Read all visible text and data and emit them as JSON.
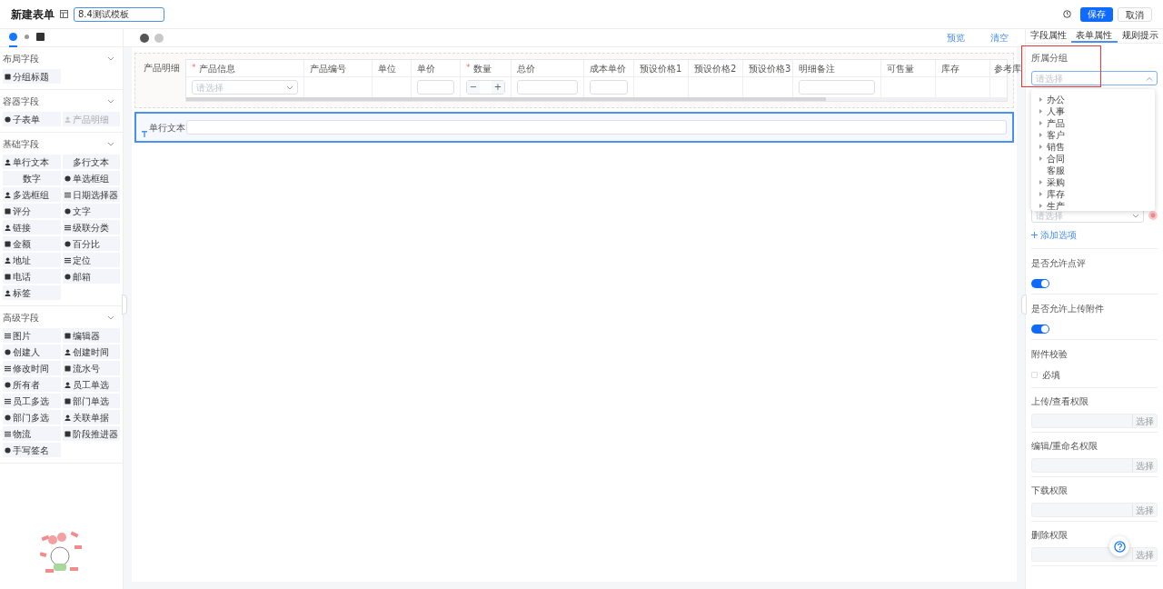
{
  "header": {
    "title": "新建表单",
    "template_name": "8.4测试模板",
    "save": "保存",
    "cancel": "取消"
  },
  "left_panel": {
    "icon_tabs": [
      {
        "selected": true
      },
      {
        "selected": false
      },
      {
        "selected": false
      }
    ],
    "sections": [
      {
        "title": "布局字段",
        "items": [
          {
            "label": "分组标题",
            "icon": true,
            "disabled": false
          }
        ]
      },
      {
        "title": "容器字段",
        "items": [
          {
            "label": "子表单",
            "icon": true,
            "disabled": false
          },
          {
            "label": "产品明细",
            "icon": true,
            "disabled": true
          }
        ]
      },
      {
        "title": "基础字段",
        "items": [
          {
            "label": "单行文本",
            "icon": true,
            "disabled": false
          },
          {
            "label": "多行文本",
            "icon": false,
            "disabled": false
          },
          {
            "label": "数字",
            "icon": false,
            "disabled": false
          },
          {
            "label": "单选框组",
            "icon": true,
            "disabled": false
          },
          {
            "label": "多选框组",
            "icon": true,
            "disabled": false
          },
          {
            "label": "日期选择器",
            "icon": true,
            "disabled": false
          },
          {
            "label": "评分",
            "icon": true,
            "disabled": false
          },
          {
            "label": "文字",
            "icon": true,
            "disabled": false
          },
          {
            "label": "链接",
            "icon": true,
            "disabled": false
          },
          {
            "label": "级联分类",
            "icon": true,
            "disabled": false
          },
          {
            "label": "金额",
            "icon": true,
            "disabled": false
          },
          {
            "label": "百分比",
            "icon": true,
            "disabled": false
          },
          {
            "label": "地址",
            "icon": true,
            "disabled": false
          },
          {
            "label": "定位",
            "icon": true,
            "disabled": false
          },
          {
            "label": "电话",
            "icon": true,
            "disabled": false
          },
          {
            "label": "邮箱",
            "icon": true,
            "disabled": false
          },
          {
            "label": "标签",
            "icon": true,
            "disabled": false
          }
        ]
      },
      {
        "title": "高级字段",
        "items": [
          {
            "label": "图片",
            "icon": true,
            "disabled": false
          },
          {
            "label": "编辑器",
            "icon": true,
            "disabled": false
          },
          {
            "label": "创建人",
            "icon": true,
            "disabled": false
          },
          {
            "label": "创建时间",
            "icon": true,
            "disabled": false
          },
          {
            "label": "修改时间",
            "icon": true,
            "disabled": false
          },
          {
            "label": "流水号",
            "icon": true,
            "disabled": false
          },
          {
            "label": "所有者",
            "icon": true,
            "disabled": false
          },
          {
            "label": "员工单选",
            "icon": true,
            "disabled": false
          },
          {
            "label": "员工多选",
            "icon": true,
            "disabled": false
          },
          {
            "label": "部门单选",
            "icon": true,
            "disabled": false
          },
          {
            "label": "部门多选",
            "icon": true,
            "disabled": false
          },
          {
            "label": "关联单据",
            "icon": true,
            "disabled": false
          },
          {
            "label": "物流",
            "icon": true,
            "disabled": false
          },
          {
            "label": "阶段推进器",
            "icon": true,
            "disabled": false
          },
          {
            "label": "手写签名",
            "icon": true,
            "disabled": false
          }
        ]
      }
    ]
  },
  "toolbar": {
    "links": [
      "预览",
      "清空"
    ]
  },
  "canvas": {
    "product_table": {
      "label": "产品明细",
      "columns": [
        {
          "title": "产品信息",
          "required_mark": "*",
          "cell": {
            "kind": "select",
            "placeholder": "请选择"
          }
        },
        {
          "title": "产品编号",
          "cell": {
            "kind": "empty"
          }
        },
        {
          "title": "单位",
          "cell": {
            "kind": "empty"
          }
        },
        {
          "title": "单价",
          "cell": {
            "kind": "input"
          }
        },
        {
          "title": "数量",
          "required_mark": "*",
          "cell": {
            "kind": "stepper",
            "minus": "−",
            "plus": "+"
          }
        },
        {
          "title": "总价",
          "cell": {
            "kind": "input"
          }
        },
        {
          "title": "成本单价",
          "cell": {
            "kind": "input"
          }
        },
        {
          "title": "预设价格1",
          "cell": {
            "kind": "empty"
          }
        },
        {
          "title": "预设价格2",
          "cell": {
            "kind": "empty"
          }
        },
        {
          "title": "预设价格3",
          "cell": {
            "kind": "empty"
          }
        },
        {
          "title": "明细备注",
          "cell": {
            "kind": "input"
          }
        },
        {
          "title": "可售量",
          "cell": {
            "kind": "empty"
          }
        },
        {
          "title": "库存",
          "cell": {
            "kind": "empty"
          }
        },
        {
          "title": "参考库",
          "cell": {
            "kind": "empty"
          }
        }
      ]
    },
    "text_field": {
      "label": "单行文本",
      "selected": true
    }
  },
  "right_panel": {
    "tabs": [
      {
        "label": "字段属性",
        "selected": false
      },
      {
        "label": "表单属性",
        "selected": true
      },
      {
        "label": "规则提示",
        "selected": false
      }
    ],
    "group": {
      "label": "所属分组",
      "placeholder": "请选择",
      "expanded": true,
      "highlighted": true,
      "options": [
        {
          "label": "办公",
          "has_children": true
        },
        {
          "label": "人事",
          "has_children": true
        },
        {
          "label": "产品",
          "has_children": true
        },
        {
          "label": "客户",
          "has_children": true
        },
        {
          "label": "销售",
          "has_children": true
        },
        {
          "label": "合同",
          "has_children": true
        },
        {
          "label": "客服",
          "has_children": false
        },
        {
          "label": "采购",
          "has_children": true
        },
        {
          "label": "库存",
          "has_children": true
        },
        {
          "label": "生产",
          "has_children": true
        }
      ]
    },
    "option_select": {
      "placeholder": "请选择"
    },
    "add_option": "添加选项",
    "toggles": [
      {
        "label": "是否允许点评",
        "on": true
      },
      {
        "label": "是否允许上传附件",
        "on": true
      }
    ],
    "attachment_check": {
      "label": "附件校验",
      "checkbox_label": "必填",
      "checked": false
    },
    "permissions": [
      {
        "label": "上传/查看权限",
        "button": "选择"
      },
      {
        "label": "编辑/重命名权限",
        "button": "选择"
      },
      {
        "label": "下载权限",
        "button": "选择"
      },
      {
        "label": "删除权限",
        "button": "选择"
      }
    ]
  }
}
